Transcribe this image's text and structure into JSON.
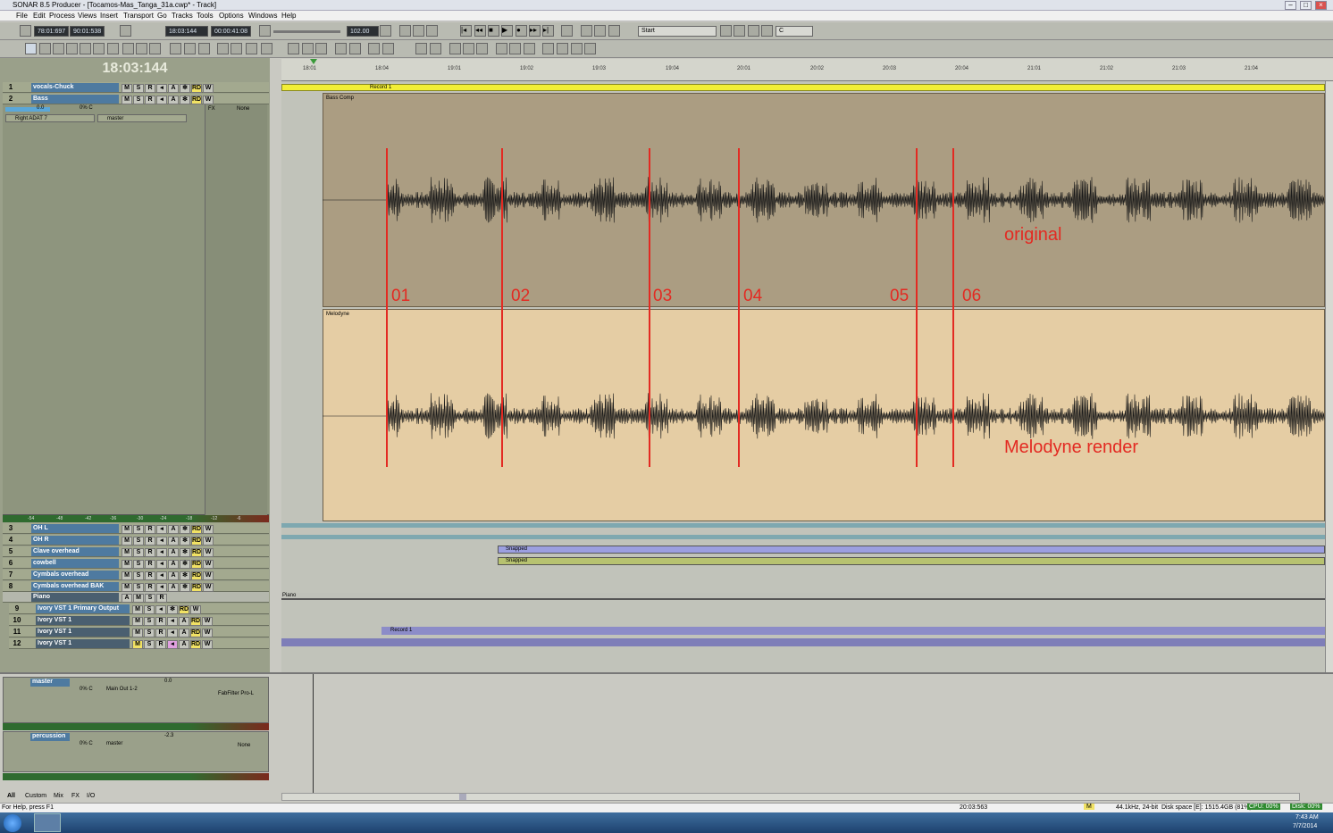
{
  "window": {
    "title": "SONAR 8.5 Producer - [Tocamos-Mas_Tanga_31a.cwp* - Track]"
  },
  "menu": [
    "File",
    "Edit",
    "Process",
    "Views",
    "Insert",
    "Transport",
    "Go",
    "Tracks",
    "Tools",
    "Options",
    "Windows",
    "Help"
  ],
  "toolbar": {
    "time1": "78:01:697",
    "time2": "90:01:538",
    "now": "18:03:144",
    "smpte": "00:00:41:08",
    "tempo": "102.00",
    "marker": "Start",
    "key": "C"
  },
  "big_time": "18:03:144",
  "ruler": [
    "18:01",
    "18:04",
    "19:01",
    "19:02",
    "19:03",
    "19:04",
    "20:01",
    "20:02",
    "20:03",
    "20:04",
    "21:01",
    "21:02",
    "21:03",
    "21:04"
  ],
  "tracks": [
    {
      "num": "1",
      "name": "vocals-Chuck"
    },
    {
      "num": "2",
      "name": "Bass"
    },
    {
      "num": "3",
      "name": "OH L"
    },
    {
      "num": "4",
      "name": "OH R"
    },
    {
      "num": "5",
      "name": "Clave overhead"
    },
    {
      "num": "6",
      "name": "cowbell"
    },
    {
      "num": "7",
      "name": "Cymbals overhead"
    },
    {
      "num": "8",
      "name": "Cymbals overhead BAK"
    },
    {
      "num": "",
      "name": "Piano"
    },
    {
      "num": "9",
      "name": "Ivory VST 1 Primary Output"
    },
    {
      "num": "10",
      "name": "Ivory VST 1"
    },
    {
      "num": "11",
      "name": "Ivory VST 1"
    },
    {
      "num": "12",
      "name": "Ivory VST 1"
    }
  ],
  "bass_track": {
    "input": "Right ADAT 7",
    "output": "master",
    "fx": "FX",
    "none": "None",
    "vol": "0.0",
    "pan": "0% C"
  },
  "meter_scale": [
    "-54",
    "-48",
    "-42",
    "-36",
    "-30",
    "-24",
    "-18",
    "-12",
    "-6"
  ],
  "clips": {
    "record": "Record 1",
    "bass_comp": "Bass Comp",
    "melodyne": "Melodyne",
    "snapped": "Snapped",
    "piano": "Piano",
    "record2": "Record 1"
  },
  "markers": [
    "01",
    "02",
    "03",
    "04",
    "05",
    "06"
  ],
  "annotations": {
    "original": "original",
    "render": "Melodyne render"
  },
  "buses": [
    {
      "name": "master",
      "output": "Main Out 1-2",
      "fx": "FabFilter Pro-L",
      "vol": "0.0",
      "pan": "0% C"
    },
    {
      "name": "percussion",
      "output": "master",
      "fx": "None",
      "vol": "-2.3",
      "pan": "0% C"
    }
  ],
  "nav_tabs": [
    "All",
    "Custom",
    "Mix",
    "FX",
    "I/O"
  ],
  "status": {
    "help": "For Help, press F1",
    "time": "20:03:563",
    "mode": "M",
    "rate": "44.1kHz, 24-bit",
    "disk": "Disk space [E]: 1515.4GB (81%)",
    "cpu": "CPU: 00%",
    "diskio": "Disk: 00%"
  },
  "taskbar": {
    "clock": "7:43 AM",
    "date": "7/7/2014"
  }
}
